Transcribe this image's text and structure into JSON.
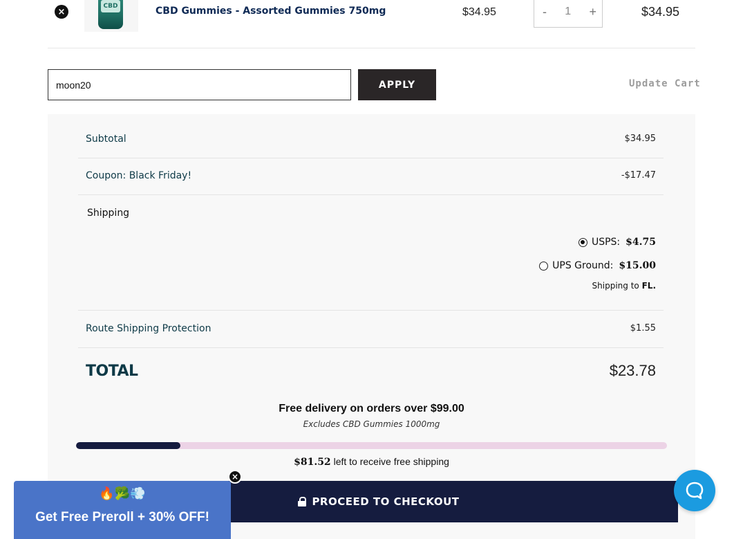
{
  "cart_item": {
    "remove_icon": "×",
    "thumb_label": "CBD",
    "name": "CBD Gummies - Assorted Gummies 750mg",
    "price": "$34.95",
    "qty_minus": "-",
    "qty_value": "1",
    "qty_plus": "+",
    "total": "$34.95"
  },
  "coupon": {
    "value": "moon20",
    "apply_label": "APPLY",
    "update_cart_label": "Update Cart"
  },
  "totals": {
    "subtotal_label": "Subtotal",
    "subtotal_value": "$34.95",
    "coupon_label": "Coupon: Black Friday!",
    "coupon_value": "-$17.47",
    "shipping_label": "Shipping",
    "shipping_options": [
      {
        "name": "USPS:",
        "price": "$4.75",
        "selected": true
      },
      {
        "name": "UPS Ground:",
        "price": "$15.00",
        "selected": false
      }
    ],
    "shipping_to_prefix": "Shipping to",
    "shipping_to_state": "FL.",
    "route_label": "Route Shipping Protection",
    "route_value": "$1.55",
    "total_label": "TOTAL",
    "total_value": "$23.78"
  },
  "free_shipping": {
    "headline": "Free delivery on orders over $99.00",
    "note": "Excludes CBD Gummies 1000mg",
    "progress_fraction": 0.177,
    "remaining_amount": "$81.52",
    "remaining_text": "left to receive free shipping"
  },
  "checkout": {
    "label": "PROCEED TO CHECKOUT",
    "icon": "lock-icon"
  },
  "promo": {
    "emoji": "🔥🥦💨",
    "text": "Get Free Preroll + 30% OFF!",
    "close_icon": "×"
  },
  "chat": {
    "icon": "chat-bubble-icon"
  },
  "colors": {
    "navy": "#151c3f",
    "teal_text": "#0e3a47",
    "progress_track": "#ecd3e6",
    "promo_blue": "#4a74c8",
    "chat_blue": "#1b9be0",
    "apply_dark": "#2a2627"
  }
}
